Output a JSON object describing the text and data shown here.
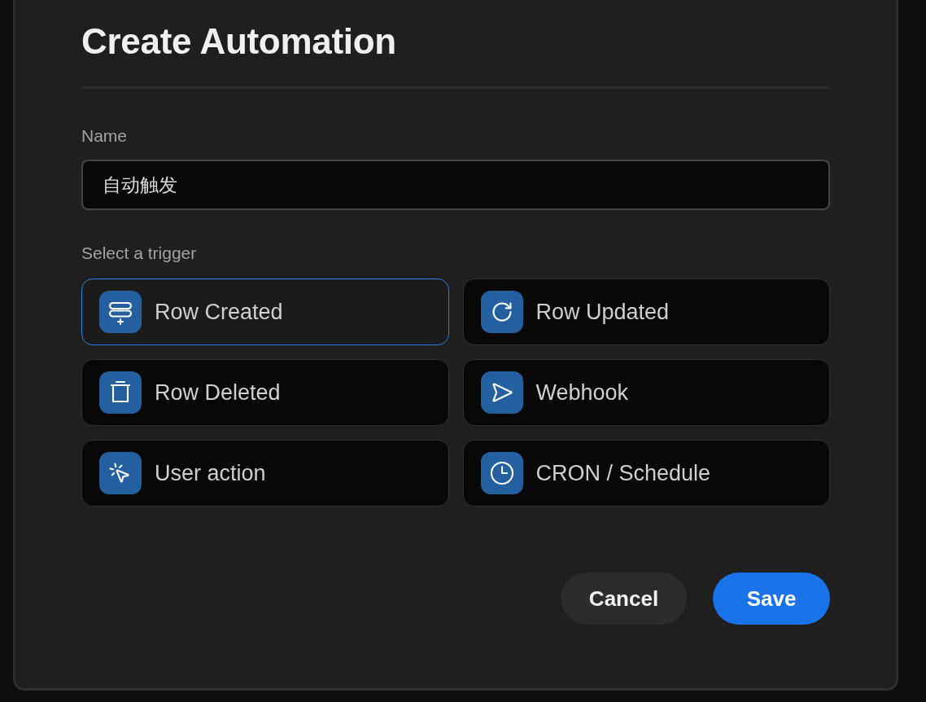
{
  "dialog": {
    "title": "Create Automation",
    "name_field": {
      "label": "Name",
      "value": "自动触发"
    },
    "trigger_label": "Select a trigger",
    "triggers": [
      {
        "label": "Row Created",
        "kind": "create",
        "selected": true
      },
      {
        "label": "Row Updated",
        "kind": "update",
        "selected": false
      },
      {
        "label": "Row Deleted",
        "kind": "delete",
        "selected": false
      },
      {
        "label": "Webhook",
        "kind": "webhook",
        "selected": false
      },
      {
        "label": "User action",
        "kind": "action",
        "selected": false
      },
      {
        "label": "CRON / Schedule",
        "kind": "schedule",
        "selected": false
      }
    ],
    "buttons": [
      {
        "label": "Cancel",
        "kind": "secondary"
      },
      {
        "label": "Save",
        "kind": "primary"
      }
    ]
  }
}
